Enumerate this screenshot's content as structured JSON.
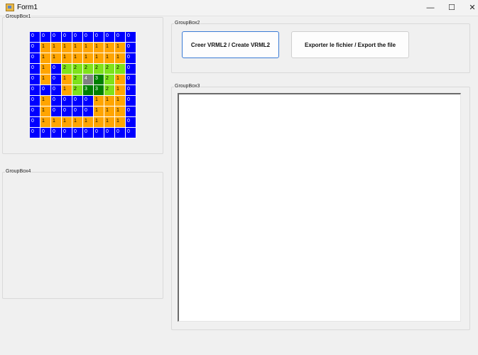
{
  "window": {
    "title": "Form1",
    "minimize_glyph": "—",
    "maximize_glyph": "☐",
    "close_glyph": "✕"
  },
  "groupbox1": {
    "label": "GroupBox1",
    "grid": [
      [
        0,
        0,
        0,
        0,
        0,
        0,
        0,
        0,
        0,
        0
      ],
      [
        0,
        1,
        1,
        1,
        1,
        1,
        1,
        1,
        1,
        0
      ],
      [
        0,
        1,
        1,
        1,
        1,
        1,
        1,
        1,
        1,
        0
      ],
      [
        0,
        1,
        0,
        2,
        2,
        2,
        2,
        2,
        2,
        0
      ],
      [
        0,
        1,
        0,
        1,
        2,
        4,
        3,
        2,
        1,
        0
      ],
      [
        0,
        0,
        0,
        1,
        2,
        3,
        3,
        2,
        1,
        0
      ],
      [
        0,
        1,
        0,
        0,
        0,
        0,
        1,
        1,
        1,
        0
      ],
      [
        0,
        1,
        0,
        0,
        0,
        0,
        1,
        1,
        1,
        0
      ],
      [
        0,
        1,
        1,
        1,
        1,
        1,
        1,
        1,
        1,
        0
      ],
      [
        0,
        0,
        0,
        0,
        0,
        0,
        0,
        0,
        0,
        0
      ]
    ],
    "colors": {
      "0": "#0000ff",
      "1": "#ffa500",
      "2": "#7fe21a",
      "3": "#008000",
      "4": "#808080"
    }
  },
  "groupbox2": {
    "label": "GroupBox2",
    "create_button": "Creer VRML2 / Create VRML2",
    "export_button": "Exporter le fichier / Export the file"
  },
  "groupbox3": {
    "label": "GroupBox3",
    "output_text": ""
  },
  "groupbox4": {
    "label": "GroupBox4"
  }
}
